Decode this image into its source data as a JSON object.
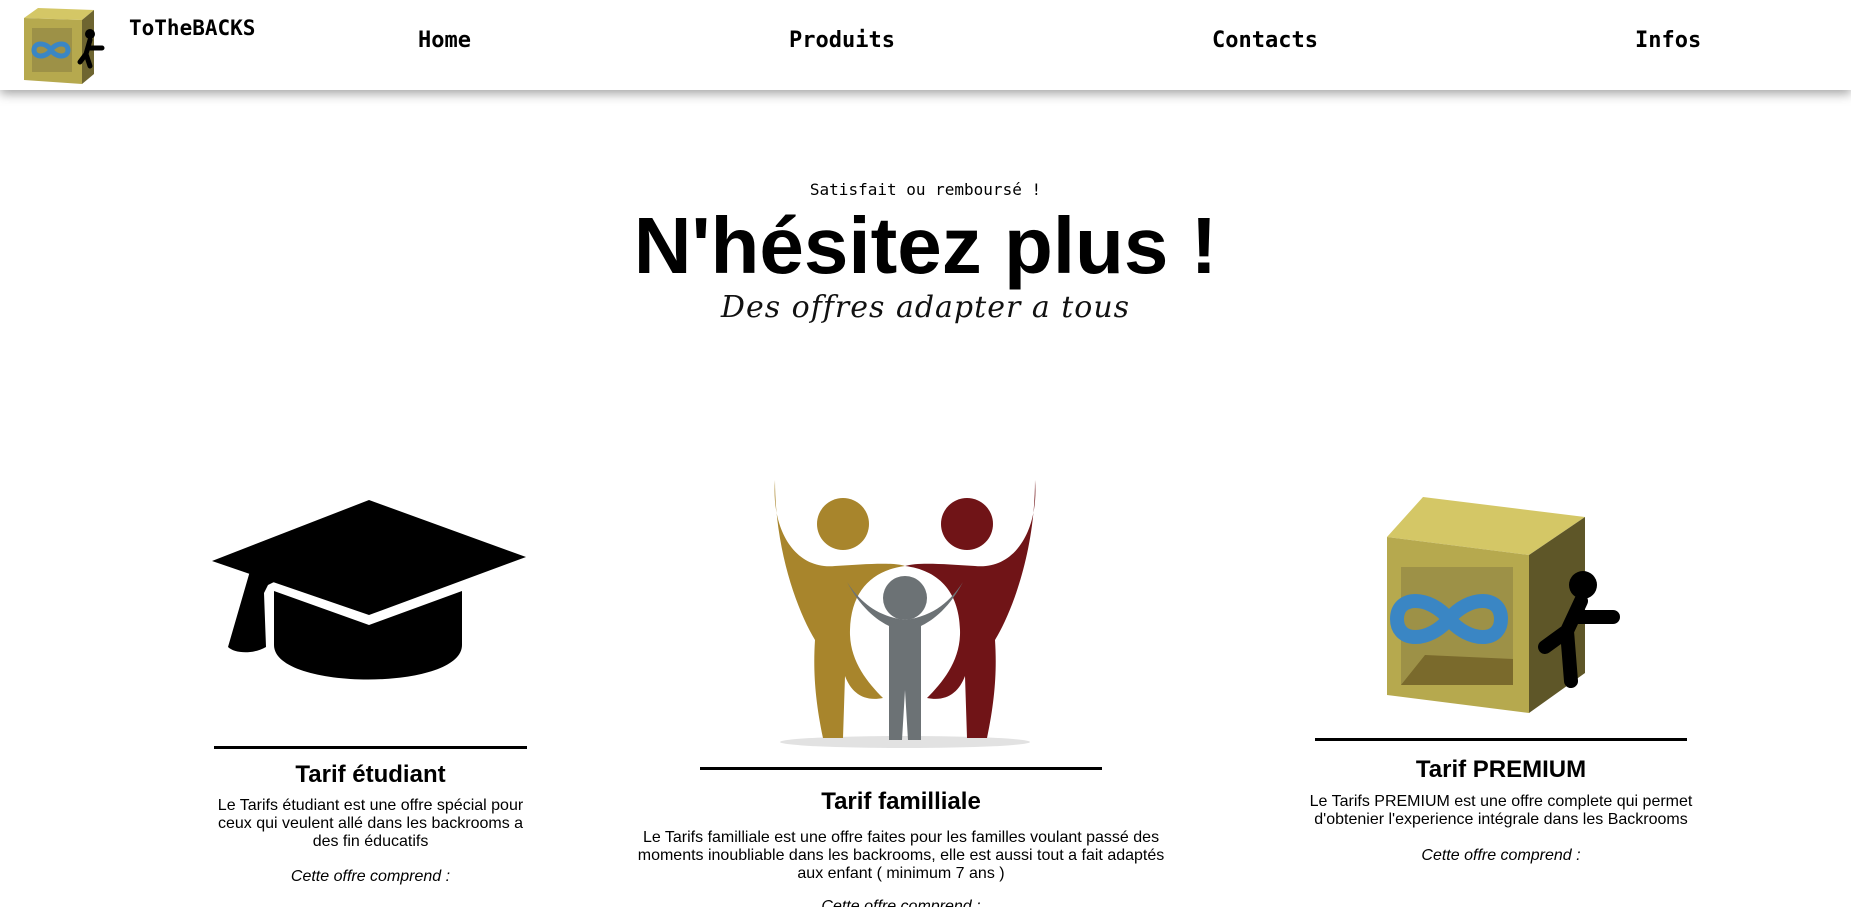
{
  "header": {
    "brand": "ToTheBACKS",
    "nav": [
      "Home",
      "Produits",
      "Contacts",
      "Infos"
    ]
  },
  "hero": {
    "kicker": "Satisfait ou remboursé !",
    "title": "N'hésitez plus !",
    "subtitle": "Des offres adapter a tous"
  },
  "offers": [
    {
      "title": "Tarif étudiant",
      "description": "Le Tarifs étudiant est une offre spécial pour ceux qui veulent allé dans les backrooms a des fin éducatifs",
      "includes": "Cette offre comprend :",
      "icon": "graduation-cap-icon"
    },
    {
      "title": "Tarif familliale",
      "description": "Le Tarifs familliale est une offre faites pour les familles voulant passé des moments inoubliable dans les backrooms, elle est aussi tout a fait adaptés aux enfant ( minimum 7 ans )",
      "includes": "Cette offre comprend :",
      "icon": "family-icon"
    },
    {
      "title": "Tarif PREMIUM",
      "description": "Le Tarifs PREMIUM est une offre complete qui permet d'obtenier l'experience intégrale dans les Backrooms",
      "includes": "Cette offre comprend :",
      "icon": "premium-box-icon"
    }
  ],
  "colors": {
    "box_gold": "#c8bb5c",
    "infinity_blue": "#3a86c4",
    "family_gold": "#a8852c",
    "family_red": "#701417",
    "family_grey": "#6c7275"
  }
}
